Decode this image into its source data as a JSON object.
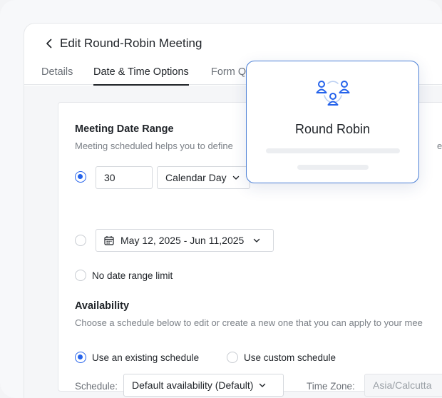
{
  "header": {
    "title": "Edit Round-Robin Meeting"
  },
  "tabs": [
    {
      "label": "Details"
    },
    {
      "label": "Date & Time Options"
    },
    {
      "label": "Form Q"
    }
  ],
  "date_range": {
    "title": "Meeting Date Range",
    "description": "Meeting scheduled helps you to define",
    "description_tail": "eeti",
    "days_value": "30",
    "day_type": "Calendar Day",
    "date_range_value": "May 12, 2025 - Jun 11,2025",
    "no_limit_label": "No date range limit"
  },
  "availability": {
    "title": "Availability",
    "description": "Choose a schedule below to edit or create a new one that you can apply to your mee",
    "existing_label": "Use an existing schedule",
    "custom_label": "Use custom schedule",
    "schedule_label": "Schedule:",
    "schedule_value": "Default availability (Default)",
    "timezone_label": "Time Zone:",
    "timezone_value": "Asia/Calcutta"
  },
  "overlay": {
    "title": "Round Robin"
  },
  "colors": {
    "accent": "#2563eb",
    "overlay_border": "#4a7fd6"
  }
}
